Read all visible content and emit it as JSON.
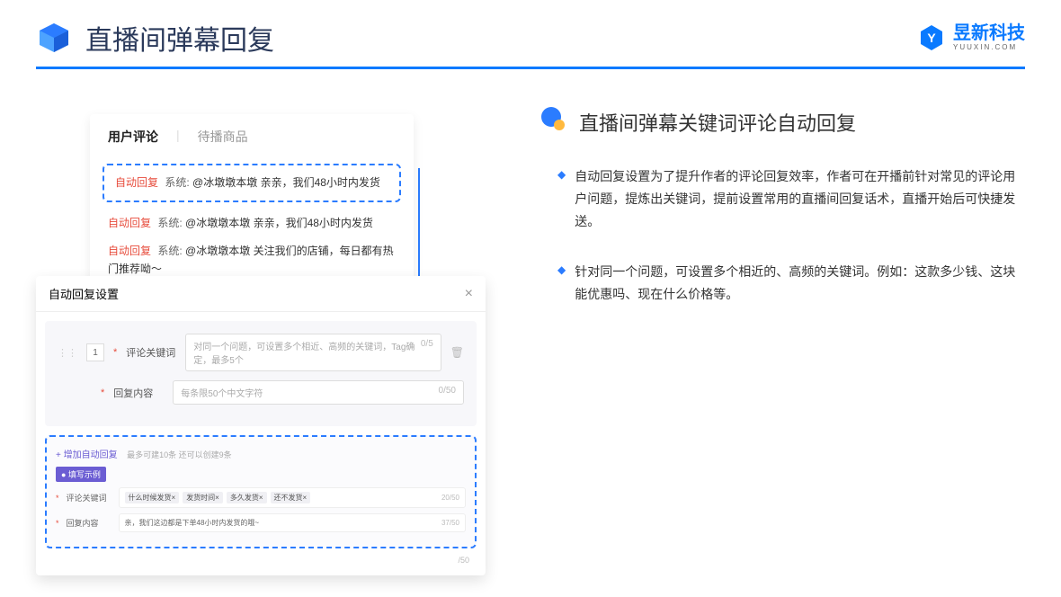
{
  "page_title": "直播间弹幕回复",
  "brand": {
    "cn": "昱新科技",
    "en": "YUUXIN.COM"
  },
  "comment_panel": {
    "tabs": {
      "active": "用户评论",
      "inactive": "待播商品"
    },
    "highlighted": {
      "tag": "自动回复",
      "sys": "系统:",
      "text": "@冰墩墩本墩 亲亲，我们48小时内发货"
    },
    "items": [
      {
        "tag": "自动回复",
        "sys": "系统:",
        "text": "@冰墩墩本墩 亲亲，我们48小时内发货"
      },
      {
        "tag": "自动回复",
        "sys": "系统:",
        "text": "@冰墩墩本墩 关注我们的店铺，每日都有热门推荐呦～"
      }
    ]
  },
  "settings": {
    "title": "自动回复设置",
    "row_num": "1",
    "keyword_label": "评论关键词",
    "keyword_placeholder": "对同一个问题，可设置多个相近、高频的关键词，Tag确定，最多5个",
    "keyword_count": "0/5",
    "content_label": "回复内容",
    "content_placeholder": "每条限50个中文字符",
    "content_count": "0/50",
    "add_link": "+ 增加自动回复",
    "add_hint": "最多可建10条 还可以创建9条",
    "example_badge": "● 填写示例",
    "ex_kw_label": "评论关键词",
    "ex_tags": [
      "什么时候发货×",
      "发货时间×",
      "多久发货×",
      "还不发货×"
    ],
    "ex_kw_count": "20/50",
    "ex_content_label": "回复内容",
    "ex_content_text": "亲，我们这边都是下单48小时内发货的哦~",
    "ex_content_count": "37/50",
    "outer_count": "/50"
  },
  "section": {
    "title": "直播间弹幕关键词评论自动回复",
    "bullets": [
      "自动回复设置为了提升作者的评论回复效率，作者可在开播前针对常见的评论用户问题，提炼出关键词，提前设置常用的直播间回复话术，直播开始后可快捷发送。",
      "针对同一个问题，可设置多个相近的、高频的关键词。例如：这款多少钱、这块能优惠吗、现在什么价格等。"
    ]
  }
}
